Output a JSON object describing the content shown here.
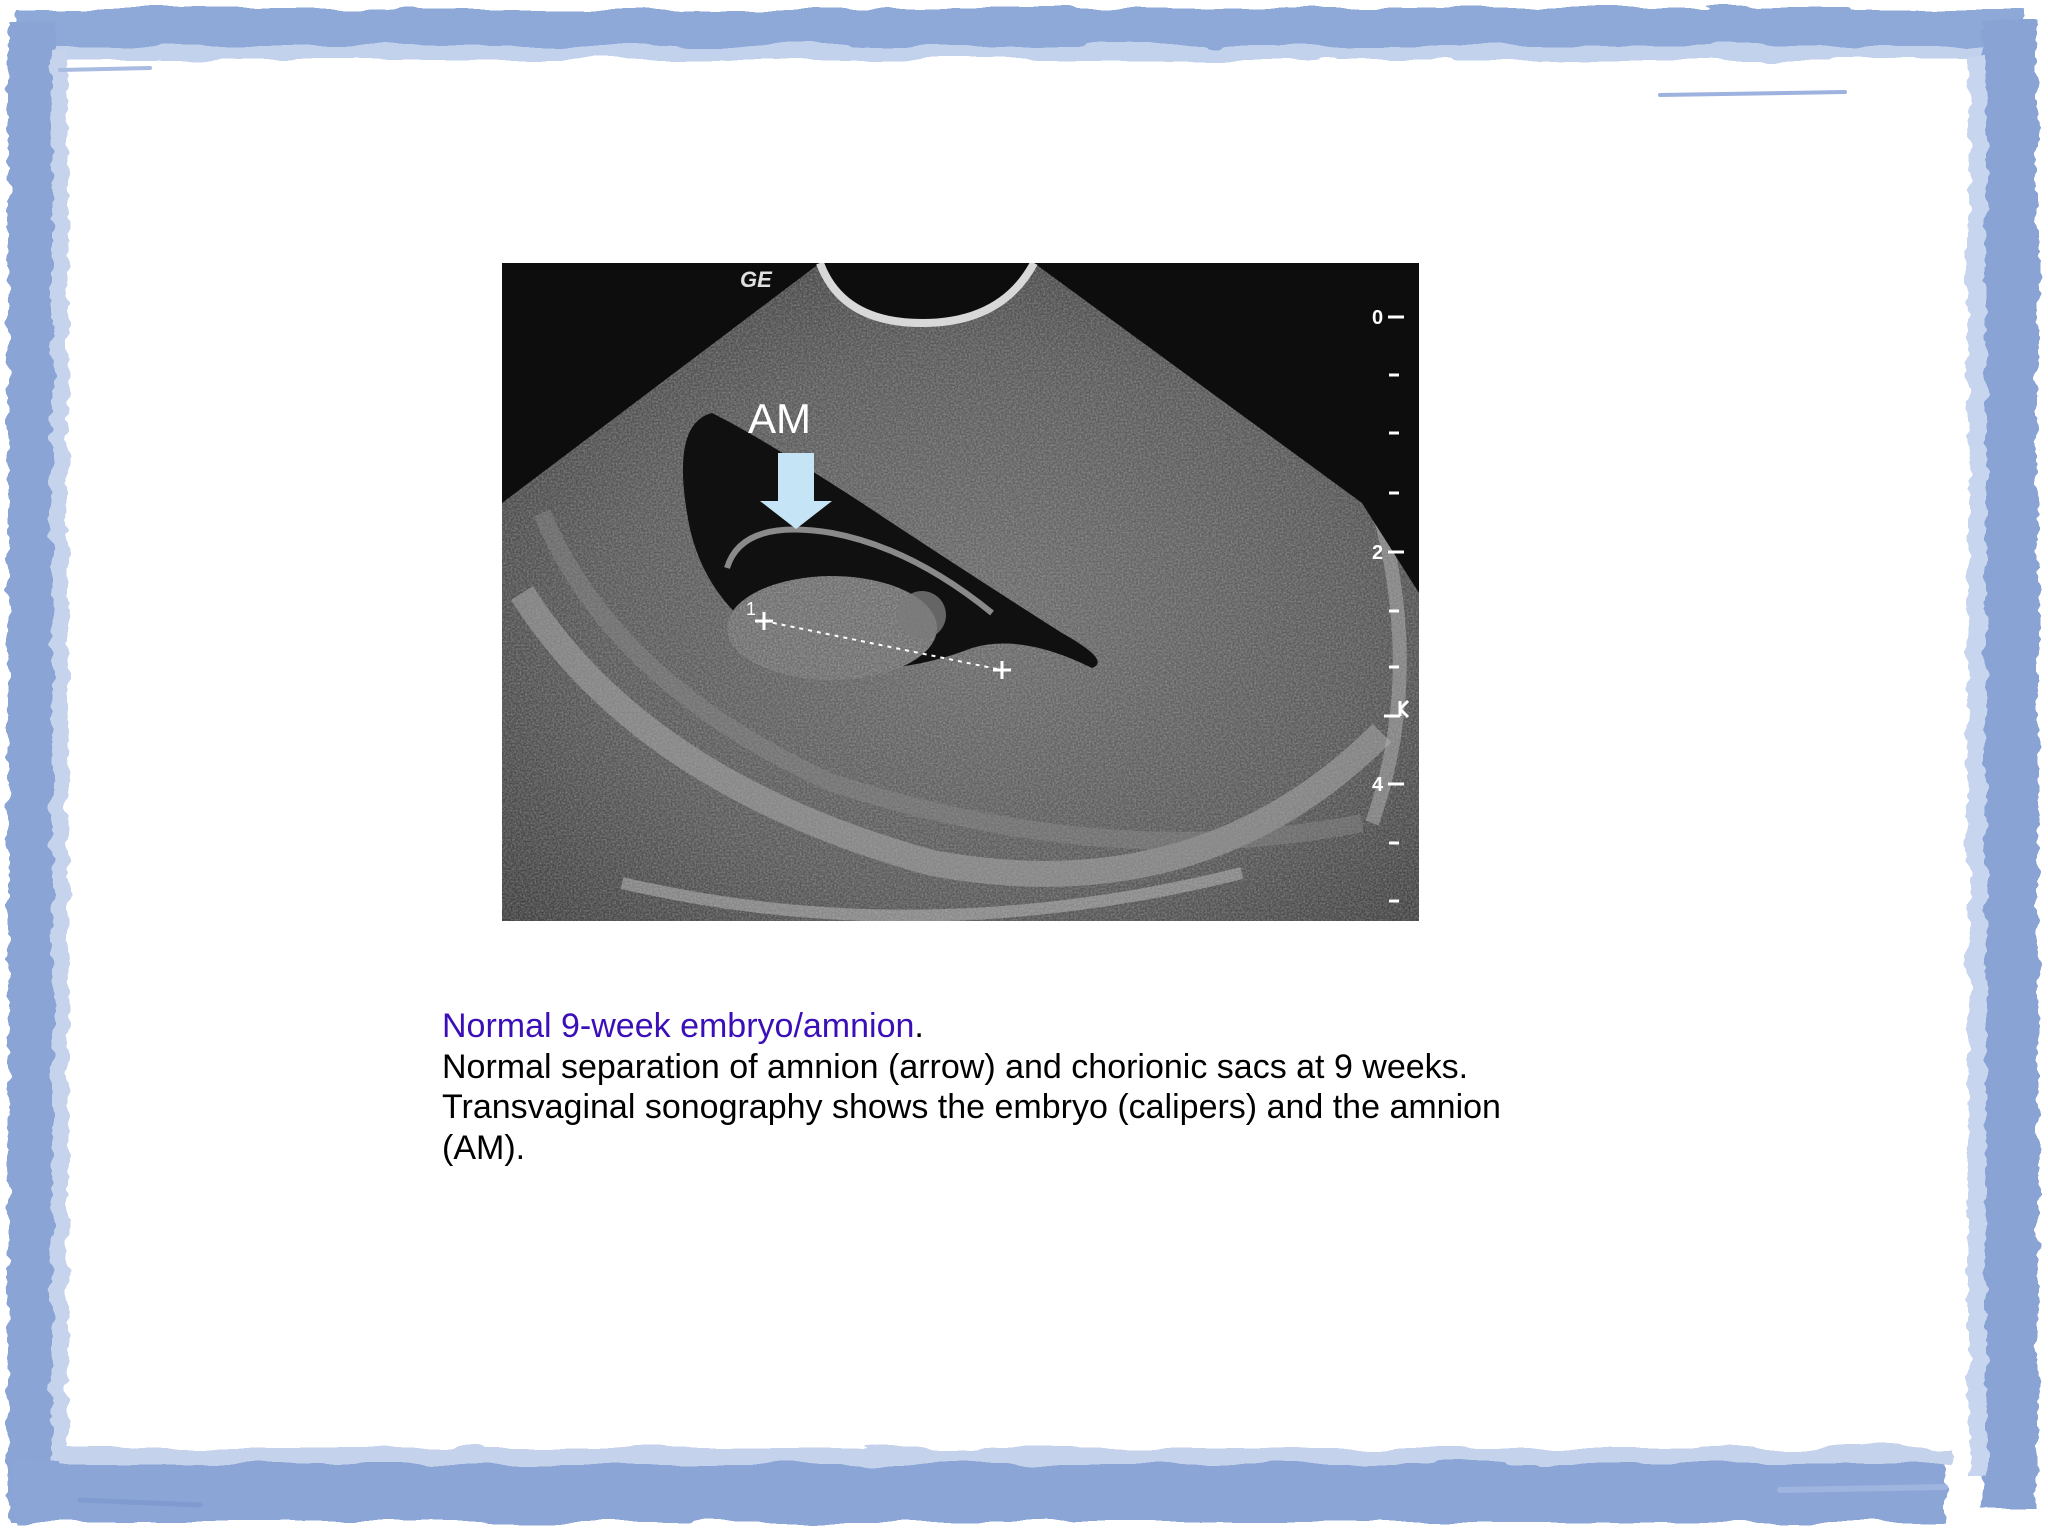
{
  "slide": {
    "frame_color": "#8aa5d6",
    "frame_inner_color": "#b9c9e8",
    "background": "#ffffff"
  },
  "image": {
    "label_am": "AM",
    "logo": "GE",
    "depth_scale": [
      "0",
      "2",
      "4"
    ],
    "caliper_label": "1",
    "focus_marker": "focus-marker-icon",
    "arrow": "down-arrow-icon"
  },
  "caption": {
    "title": "Normal 9-week embryo/amnion",
    "title_punctuation": ".",
    "title_color": "#3b0fb8",
    "body": "Normal separation of amnion (arrow) and chorionic sacs at 9 weeks. Transvaginal sonography shows the embryo (calipers) and the amnion (AM)."
  }
}
